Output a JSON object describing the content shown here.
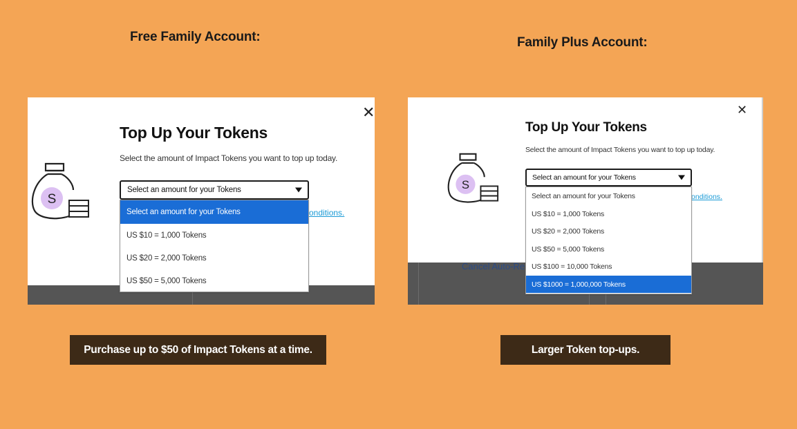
{
  "left": {
    "heading": "Free Family Account:",
    "modal": {
      "title": "Top Up Your Tokens",
      "description": "Select the amount of Impact Tokens you want to top up today.",
      "select_value": "Select an amount for your Tokens",
      "options": [
        "Select an amount for your Tokens",
        "US $10 = 1,000 Tokens",
        "US $20 = 2,000 Tokens",
        "US $50 = 5,000 Tokens"
      ],
      "selected_option": "Select an amount for your Tokens",
      "terms_link_fragment": "onditions.",
      "close_symbol": "✕",
      "icon_letter": "S"
    },
    "caption": "Purchase up to $50 of Impact Tokens at a time."
  },
  "right": {
    "heading": "Family Plus Account:",
    "modal": {
      "title": "Top Up Your Tokens",
      "description": "Select the amount of Impact Tokens you want to top up today.",
      "select_value": "Select an amount for your Tokens",
      "options": [
        "Select an amount for your Tokens",
        "US $10 = 1,000 Tokens",
        "US $20 = 2,000 Tokens",
        "US $50 = 5,000 Tokens",
        "US $100 = 10,000 Tokens",
        "US $1000 = 1,000,000 Tokens"
      ],
      "selected_option": "US $1000 = 1,000,000 Tokens",
      "terms_link_fragment": "onditions.",
      "cancel_fragment": "Cancel Auto-Re",
      "close_symbol": "✕",
      "icon_letter": "S"
    },
    "caption": "Larger Token top-ups."
  },
  "colors": {
    "background": "#f4a555",
    "caption_bg": "#3d2a17",
    "selected_option": "#1a6dd6",
    "link": "#1a9ad6",
    "icon_coin": "#dcc0f2"
  }
}
